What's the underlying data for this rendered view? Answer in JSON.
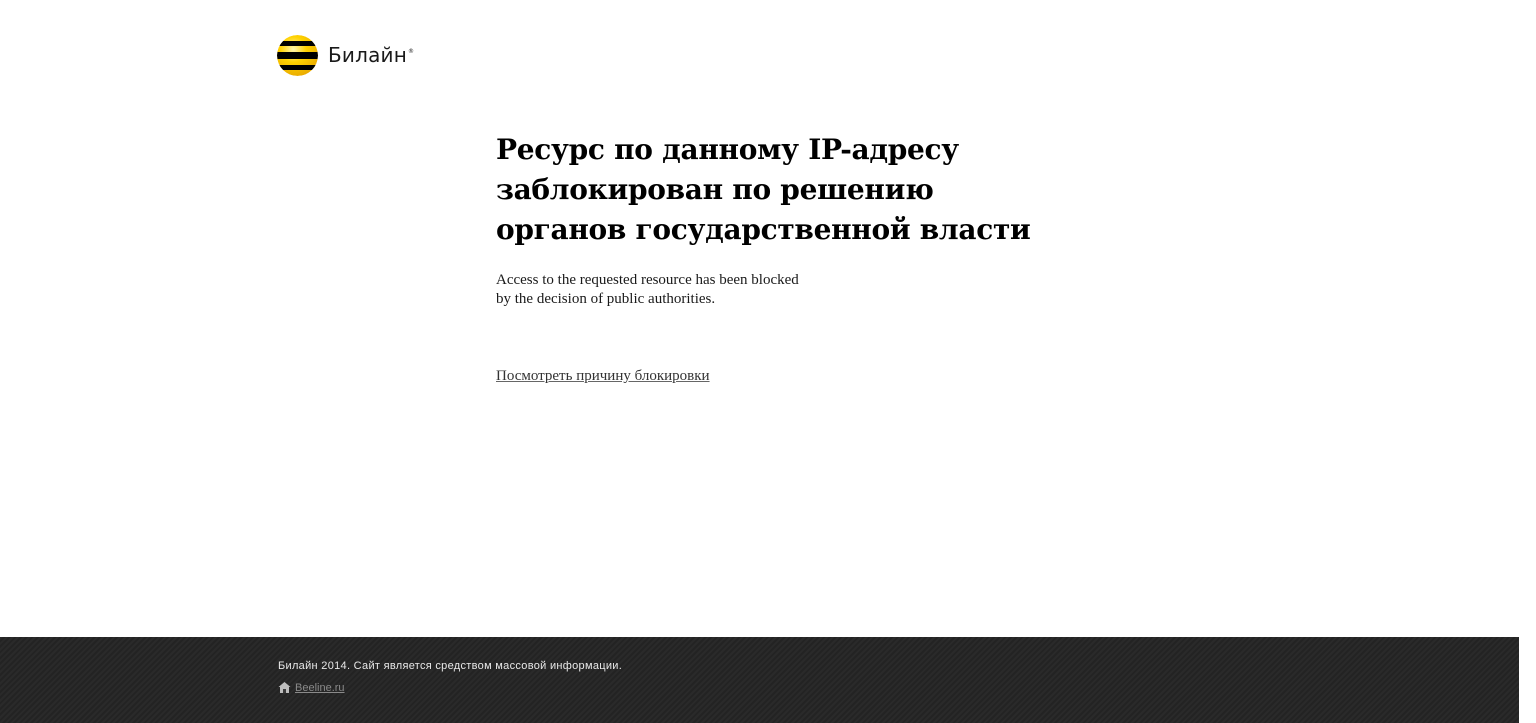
{
  "header": {
    "logo_text": "Билайн",
    "logo_reg": "®"
  },
  "main": {
    "headline_lines": [
      "Ресурс по данному IP-адресу",
      "заблокирован по решению",
      "органов государственной власти"
    ],
    "sub_lines": [
      "Access to the requested resource has been blocked",
      "by the decision of public authorities."
    ],
    "reason_link": "Посмотреть причину блокировки"
  },
  "footer": {
    "copyright": "Билайн 2014. Сайт является средством массовой информации.",
    "home_link": "Beeline.ru"
  },
  "colors": {
    "brand_yellow": "#ffd200",
    "brand_black": "#000000",
    "footer_bg": "#262626"
  }
}
